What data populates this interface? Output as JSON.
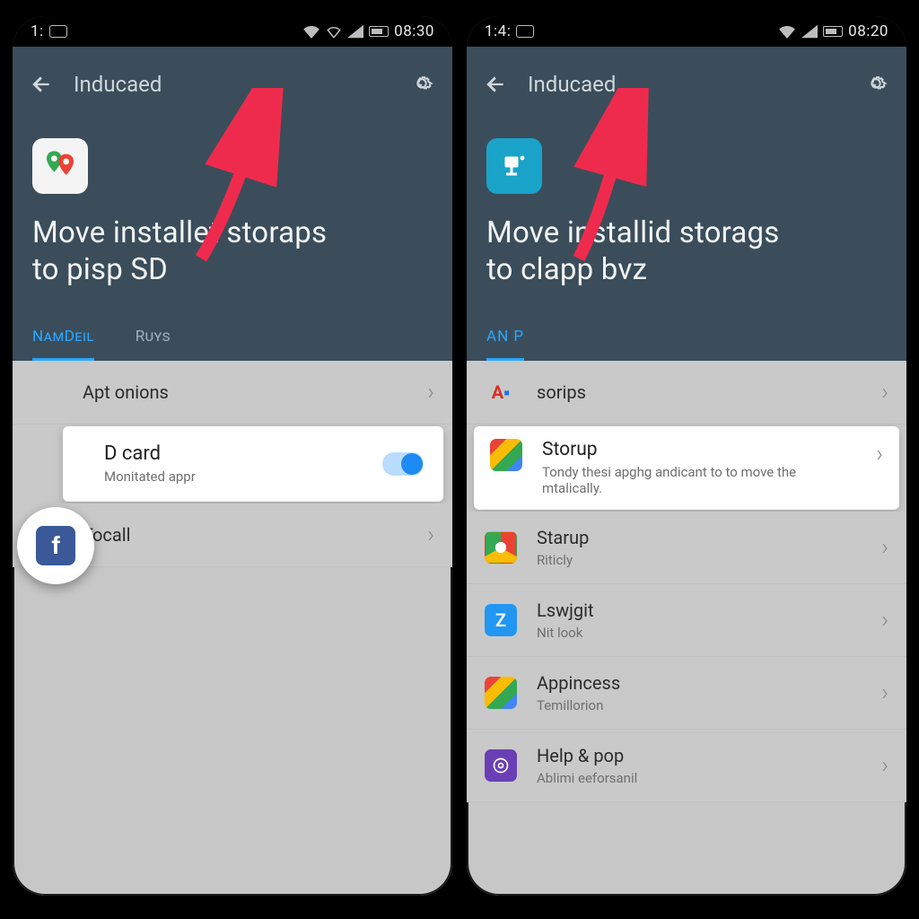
{
  "left": {
    "status": {
      "time": "1:",
      "clock": "08:30"
    },
    "header": {
      "title": "Inducaed",
      "bigline1": "Move installet storaps",
      "bigline2": "to pisp SD"
    },
    "tabs": {
      "a": "NamDeil",
      "b": "Ruys"
    },
    "rows": {
      "r1": "Apt onions",
      "r2_title": "D card",
      "r2_sub": "Monitated appr",
      "r3": "Tocall"
    }
  },
  "right": {
    "status": {
      "time": "1:4:",
      "clock": "08:20"
    },
    "header": {
      "title": "Inducaed",
      "bigline1": "Move installid storags",
      "bigline2": "to clapp bvz"
    },
    "tabs": {
      "a": "AN P"
    },
    "rows": {
      "r1": "sorips",
      "card_title": "Storup",
      "card_sub": "Tondy thesi apghg andicant to to move the mtalically.",
      "r3": "Starup",
      "r3s": "Riticly",
      "r4": "Lswjgit",
      "r4s": "Nit look",
      "r5": "Appincess",
      "r5s": "Temillorion",
      "r6": "Help & pop",
      "r6s": "Ablimi eeforsanil"
    }
  }
}
